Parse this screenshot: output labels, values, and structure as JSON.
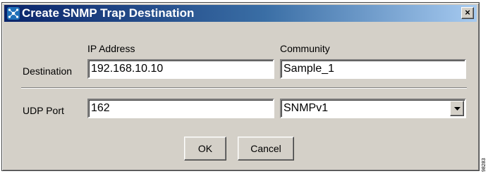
{
  "window": {
    "title": "Create SNMP Trap Destination",
    "close_label": "×",
    "icon": "snmp-network-icon"
  },
  "form": {
    "ip_address_label": "IP Address",
    "community_label": "Community",
    "destination_label": "Destination",
    "ip_address_value": "192.168.10.10",
    "community_value": "Sample_1",
    "udp_port_label": "UDP Port",
    "udp_port_value": "162",
    "version_selected": "SNMPv1"
  },
  "buttons": {
    "ok_label": "OK",
    "cancel_label": "Cancel"
  },
  "side_mark": "98283",
  "colors": {
    "title_bar_start": "#0a246a",
    "title_bar_end": "#a6caf0",
    "dialog_background": "#d4d0c8"
  }
}
